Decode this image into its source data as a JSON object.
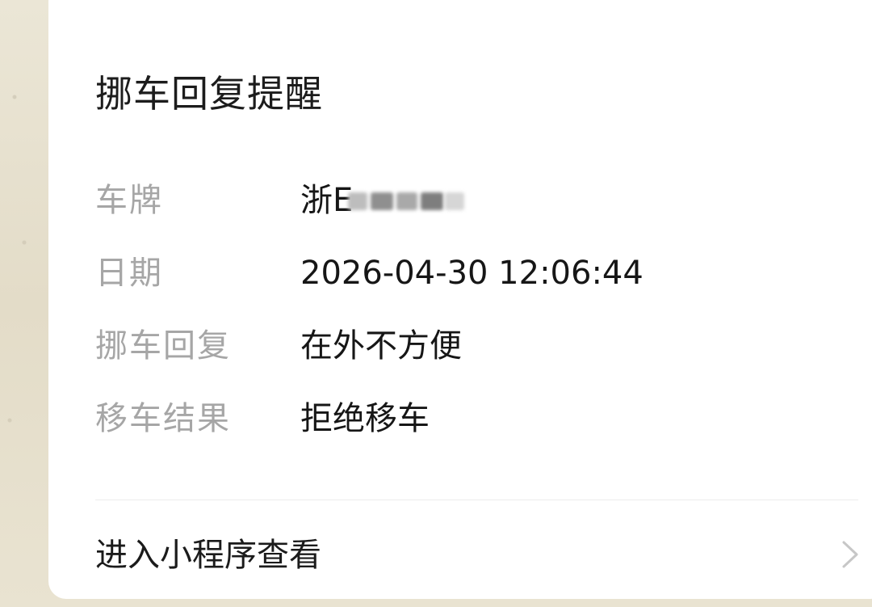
{
  "card": {
    "title": "挪车回复提醒",
    "fields": [
      {
        "label": "车牌",
        "value": "浙E"
      },
      {
        "label": "日期",
        "value": "2026-04-30 12:06:44"
      },
      {
        "label": "挪车回复",
        "value": "在外不方便"
      },
      {
        "label": "移车结果",
        "value": "拒绝移车"
      }
    ],
    "footer": {
      "link_label": "进入小程序查看",
      "icon": "chevron-right-icon"
    }
  },
  "colors": {
    "title": "#1c1c1c",
    "label": "#a6a6a6",
    "value": "#161616",
    "divider": "#ececec",
    "chevron": "#c7c7c7"
  }
}
